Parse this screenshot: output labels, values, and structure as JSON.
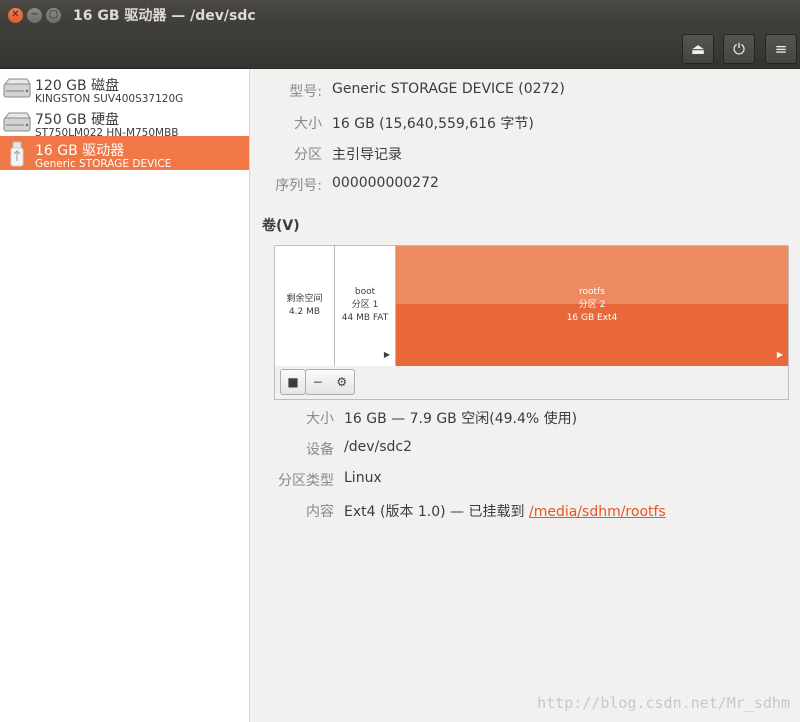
{
  "window": {
    "title": "16 GB 驱动器 — /dev/sdc",
    "controls": [
      "close-icon",
      "minimize-icon",
      "maximize-icon"
    ]
  },
  "header": {
    "buttons": [
      {
        "name": "eject-button",
        "icon": "eject-icon",
        "glyph": "⏏"
      },
      {
        "name": "power-button",
        "icon": "power-icon",
        "glyph": "⏻"
      },
      {
        "name": "menu-button",
        "icon": "hamburger-menu-icon",
        "glyph": "≡"
      }
    ]
  },
  "sidebar": {
    "drives": [
      {
        "name": "120 GB 磁盘",
        "model": "KINGSTON SUV400S37120G",
        "icon": "hard-disk-icon",
        "selected": false
      },
      {
        "name": "750 GB 硬盘",
        "model": "ST750LM022 HN-M750MBB",
        "icon": "hard-disk-icon",
        "selected": false
      },
      {
        "name": "16 GB 驱动器",
        "model": "Generic STORAGE DEVICE",
        "icon": "usb-drive-icon",
        "selected": true
      }
    ]
  },
  "drive_info": {
    "model_label": "型号:",
    "model_value": "Generic STORAGE DEVICE (0272)",
    "size_label": "大小",
    "size_value": "16 GB (15,640,559,616 字节)",
    "partitioning_label": "分区",
    "partitioning_value": "主引导记录",
    "serial_label": "序列号:",
    "serial_value": "000000000272"
  },
  "volumes": {
    "title": "卷(V)",
    "segments": [
      {
        "line1": "剩余空间",
        "line2": "4.2 MB",
        "line3": "",
        "selected": false
      },
      {
        "line1": "boot",
        "line2": "分区 1",
        "line3": "44 MB FAT",
        "selected": false
      },
      {
        "line1": "rootfs",
        "line2": "分区 2",
        "line3": "16 GB Ext4",
        "selected": true
      }
    ],
    "toolbar": {
      "stop_glyph": "■",
      "remove_glyph": "−",
      "settings_glyph": "⚙"
    }
  },
  "partition_info": {
    "size_label": "大小",
    "size_value": "16 GB — 7.9 GB 空闲(49.4% 使用)",
    "device_label": "设备",
    "device_value": "/dev/sdc2",
    "type_label": "分区类型",
    "type_value": "Linux",
    "contents_label": "内容",
    "contents_value": "Ext4 (版本 1.0) — 已挂载到",
    "mount_link": "/media/sdhm/rootfs"
  },
  "watermark": "http://blog.csdn.net/Mr_sdhm",
  "colors": {
    "accent": "#f07746",
    "selected_segment": "#e8683a",
    "link": "#e95420"
  }
}
